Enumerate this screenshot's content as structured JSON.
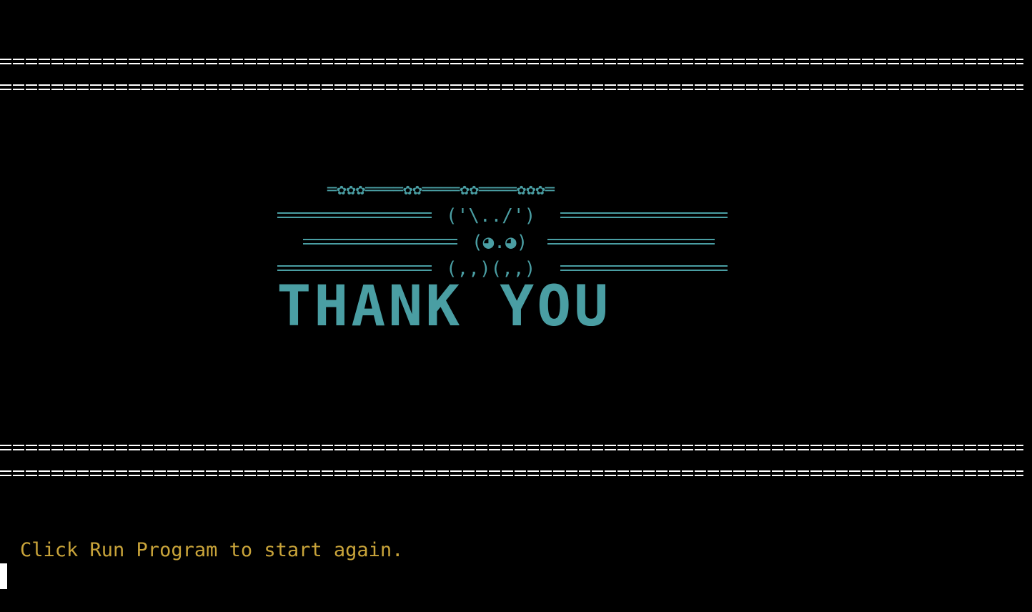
{
  "terminal": {
    "background": "#000000",
    "rule_color": "#ffffff",
    "art_color": "#4a9ea3",
    "prompt_color": "#c9a43a"
  },
  "banner": {
    "flower_row": "═✿✿✿════✿✿════✿✿════✿✿✿═",
    "ears": "('\\../')",
    "face": "(◕.◕)",
    "paws": "(,,)(,,)",
    "title": "THANK YOU"
  },
  "footer": {
    "message": "Click Run Program to start again."
  },
  "icons": {
    "cursor": "block-cursor-icon"
  }
}
